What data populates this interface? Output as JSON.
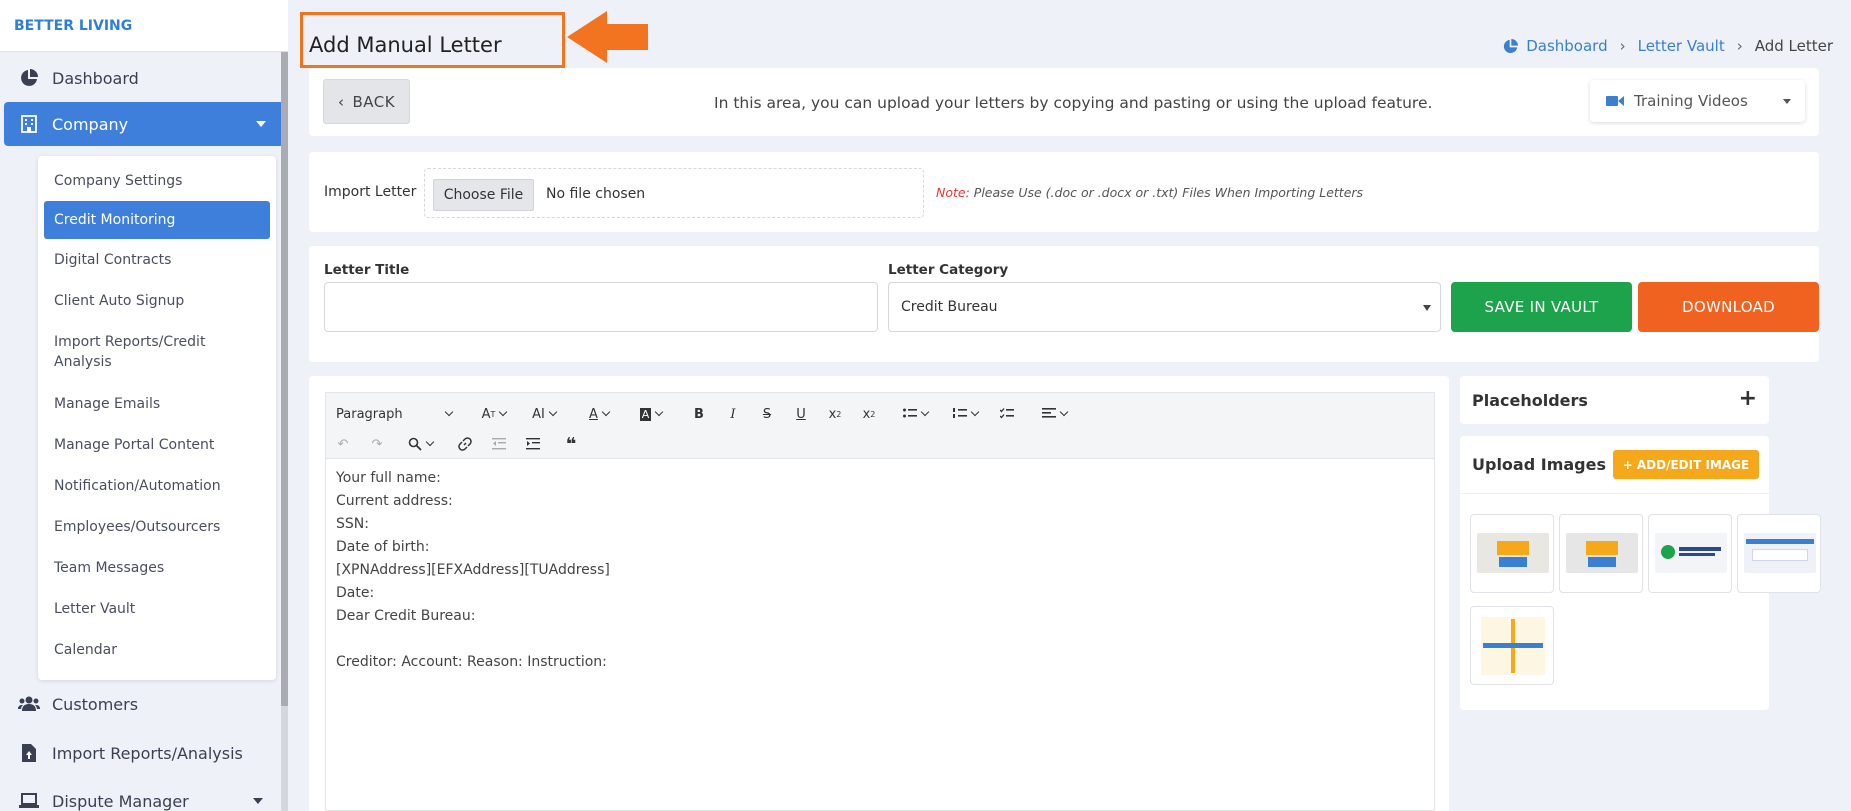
{
  "brand": "BETTER LIVING",
  "nav": {
    "dashboard": "Dashboard",
    "company": "Company",
    "customers": "Customers",
    "import_reports": "Import Reports/Analysis",
    "dispute_manager": "Dispute Manager"
  },
  "submenu": [
    "Company Settings",
    "Credit Monitoring",
    "Digital Contracts",
    "Client Auto Signup",
    "Import Reports/Credit Analysis",
    "Manage Emails",
    "Manage Portal Content",
    "Notification/Automation",
    "Employees/Outsourcers",
    "Team Messages",
    "Letter Vault",
    "Calendar"
  ],
  "page_title": "Add Manual Letter",
  "breadcrumb": {
    "dashboard": "Dashboard",
    "letter_vault": "Letter Vault",
    "current": "Add Letter"
  },
  "info": {
    "back": "BACK",
    "text": "In this area, you can upload your letters by copying and pasting or using the upload feature.",
    "training": "Training Videos"
  },
  "import": {
    "label": "Import Letter",
    "choose": "Choose File",
    "no_file": "No file chosen",
    "note_label": "Note:",
    "note_text": "Please Use (.doc or .docx or .txt) Files When Importing Letters"
  },
  "form": {
    "title_label": "Letter Title",
    "title_value": "",
    "category_label": "Letter Category",
    "category_value": "Credit Bureau",
    "save": "SAVE IN VAULT",
    "download": "DOWNLOAD"
  },
  "editor": {
    "paragraph": "Paragraph",
    "lines": [
      "Your full name:",
      "Current address:",
      "SSN:",
      "Date of birth:",
      "[XPNAddress][EFXAddress][TUAddress]",
      "Date:",
      "Dear Credit Bureau:",
      "",
      "Creditor: Account: Reason: Instruction:"
    ]
  },
  "placeholders": {
    "title": "Placeholders"
  },
  "upload": {
    "title": "Upload Images",
    "add": "ADD/EDIT IMAGE",
    "thumbs": [
      {
        "name": "dispute-thumb",
        "color": "#e9e7e2"
      },
      {
        "name": "billing-thumb",
        "color": "#e6e6e6"
      },
      {
        "name": "business-thumb",
        "color": "#f3f4f8"
      },
      {
        "name": "software-thumb",
        "color": "#eef2f8"
      },
      {
        "name": "manager-thumb",
        "color": "#fdf6e3"
      }
    ]
  },
  "colors": {
    "primary": "#3f7fdc",
    "success": "#1ea34d",
    "orange": "#f0621f",
    "warning": "#f6a81b"
  }
}
